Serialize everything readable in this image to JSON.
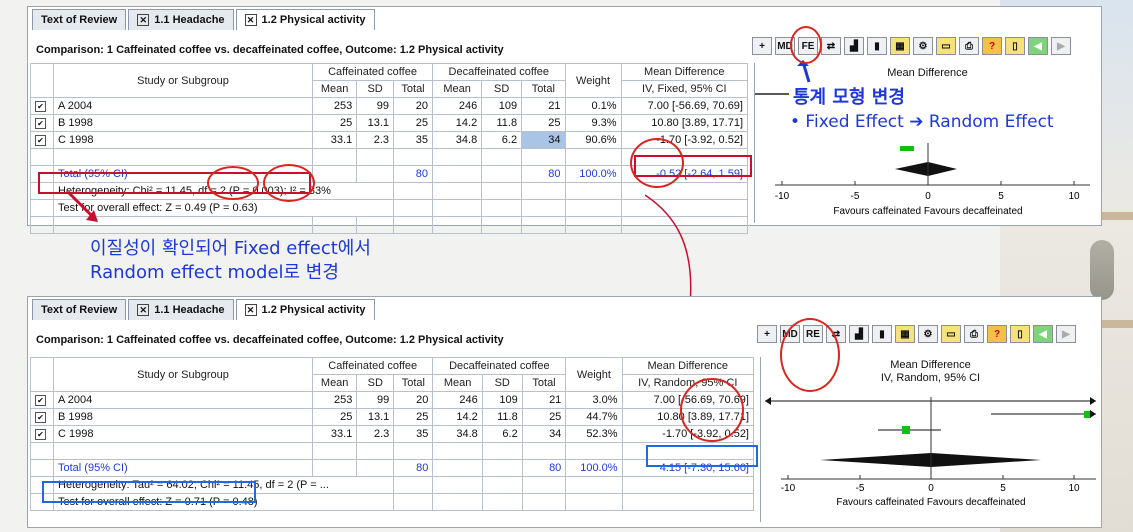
{
  "tabs": [
    "Text of Review",
    "1.1 Headache",
    "1.2 Physical activity"
  ],
  "comparison": "Comparison: 1 Caffeinated coffee vs. decaffeinated coffee, Outcome: 1.2 Physical activity",
  "headers": {
    "study": "Study or Subgroup",
    "caff": "Caffeinated coffee",
    "decaf": "Decaffeinated coffee",
    "mean": "Mean",
    "sd": "SD",
    "total": "Total",
    "weight": "Weight",
    "md": "Mean Difference"
  },
  "toolbar_top": [
    "MD",
    "FE"
  ],
  "toolbar_bottom": [
    "MD",
    "RE"
  ],
  "top": {
    "method": "IV, Fixed, 95% CI",
    "rows": [
      {
        "study": "A 2004",
        "m1": "253",
        "sd1": "99",
        "n1": "20",
        "m2": "246",
        "sd2": "109",
        "n2": "21",
        "w": "0.1%",
        "ci": "7.00 [-56.69, 70.69]"
      },
      {
        "study": "B 1998",
        "m1": "25",
        "sd1": "13.1",
        "n1": "25",
        "m2": "14.2",
        "sd2": "11.8",
        "n2": "25",
        "w": "9.3%",
        "ci": "10.80 [3.89, 17.71]"
      },
      {
        "study": "C 1998",
        "m1": "33.1",
        "sd1": "2.3",
        "n1": "35",
        "m2": "34.8",
        "sd2": "6.2",
        "n2": "34",
        "w": "90.6%",
        "ci": "-1.70 [-3.92, 0.52]"
      }
    ],
    "total_label": "Total (95% CI)",
    "total_n1": "80",
    "total_n2": "80",
    "total_w": "100.0%",
    "total_ci": "-0.52 [-2.64, 1.59]",
    "heterogeneity": "Heterogeneity: Chi² = 11.45, df = 2 (P = 0.003); I² = 83%",
    "overall": "Test for overall effect: Z = 0.49 (P = 0.63)",
    "plot_title": "Mean Difference",
    "ticks": [
      "-10",
      "-5",
      "0",
      "5",
      "10"
    ],
    "favours": "Favours caffeinated   Favours decaffeinated"
  },
  "bottom": {
    "method": "IV, Random, 95% CI",
    "rows": [
      {
        "study": "A 2004",
        "m1": "253",
        "sd1": "99",
        "n1": "20",
        "m2": "246",
        "sd2": "109",
        "n2": "21",
        "w": "3.0%",
        "ci": "7.00 [-56.69, 70.69]"
      },
      {
        "study": "B 1998",
        "m1": "25",
        "sd1": "13.1",
        "n1": "25",
        "m2": "14.2",
        "sd2": "11.8",
        "n2": "25",
        "w": "44.7%",
        "ci": "10.80 [3.89, 17.71]"
      },
      {
        "study": "C 1998",
        "m1": "33.1",
        "sd1": "2.3",
        "n1": "35",
        "m2": "34.8",
        "sd2": "6.2",
        "n2": "34",
        "w": "52.3%",
        "ci": "-1.70 [-3.92, 0.52]"
      }
    ],
    "total_label": "Total (95% CI)",
    "total_n1": "80",
    "total_n2": "80",
    "total_w": "100.0%",
    "total_ci": "4.15 [-7.30, 15.60]",
    "heterogeneity": "Heterogeneity: Tau² = 64.02; Chi² = 11.45, df = 2 (P = ...",
    "overall": "Test for overall effect: Z = 0.71 (P = 0.48)",
    "plot_title": "Mean Difference",
    "plot_method": "IV, Random, 95% CI",
    "ticks": [
      "-10",
      "-5",
      "0",
      "5",
      "10"
    ],
    "favours": "Favours caffeinated   Favours decaffeinated"
  },
  "annotations": {
    "model_change_title": "통계 모형 변경",
    "model_change_detail": "•    Fixed Effect ➔ Random Effect",
    "heterogeneity_note_1": "이질성이 확인되어 Fixed effect에서",
    "heterogeneity_note_2": "Random effect model로 변경"
  },
  "colors": {
    "annotation_blue": "#1d38d8",
    "circle_red": "#d8261e",
    "box_blue": "#1e6be0",
    "marker_green": "#10c010"
  }
}
